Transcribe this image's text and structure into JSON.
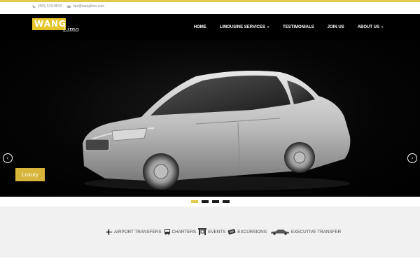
{
  "topbar": {
    "phone": "(415) 513-8813",
    "email": "tips@wanglimo.com"
  },
  "logo": {
    "brand": "WANG",
    "sub": "Limo"
  },
  "nav": {
    "items": [
      {
        "label": "HOME"
      },
      {
        "label": "LIMOUSINE SERVICES",
        "dropdown": true
      },
      {
        "label": "TESTIMONIALS"
      },
      {
        "label": "JOIN US"
      },
      {
        "label": "ABOUT US",
        "dropdown": true
      }
    ]
  },
  "slider": {
    "caption": "Luxury",
    "slides_total": 4,
    "active_slide": 1,
    "prev_glyph": "‹",
    "next_glyph": "›"
  },
  "services": [
    {
      "label": "AIRPORT TRANSFERS",
      "icon": "airplane-icon"
    },
    {
      "label": "CHARTERS",
      "icon": "bus-icon"
    },
    {
      "label": "EVENTS",
      "icon": "gate-icon"
    },
    {
      "label": "EXCURSIONS",
      "icon": "ticket-icon"
    },
    {
      "label": "EXECUTIVE TRANSFER",
      "icon": "sedan-icon"
    }
  ],
  "colors": {
    "accent": "#e2c94a",
    "nav_bg": "#000000",
    "services_bg": "#f1f1f1"
  }
}
